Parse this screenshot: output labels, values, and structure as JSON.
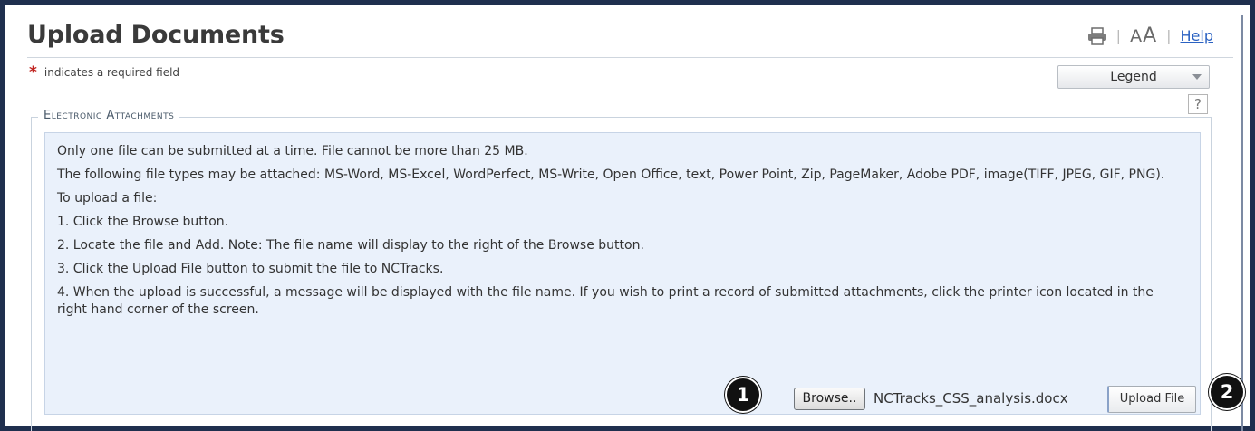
{
  "page": {
    "title": "Upload Documents",
    "required_note": "indicates a required field",
    "required_marker": "*"
  },
  "tools": {
    "print_icon": "printer-icon",
    "font_small": "A",
    "font_large": "A",
    "help_label": "Help"
  },
  "legend_dropdown": {
    "label": "Legend"
  },
  "help_box": {
    "label": "?"
  },
  "section": {
    "legend": "Electronic Attachments",
    "instructions": [
      "Only one file can be submitted at a time. File cannot be more than 25 MB.",
      "The following file types may be attached: MS-Word, MS-Excel, WordPerfect, MS-Write, Open Office, text, Power Point, Zip, PageMaker, Adobe PDF, image(TIFF, JPEG, GIF, PNG).",
      "To upload a file:",
      "1. Click the Browse button.",
      "2. Locate the file and Add. Note: The file name will display to the right of the Browse button.",
      "3. Click the Upload File button to submit the file to NCTracks.",
      "4. When the upload is successful, a message will be displayed with the file name. If you wish to print a record of submitted attachments, click the printer icon located in the right hand corner of the screen."
    ]
  },
  "upload": {
    "browse_label": "Browse..",
    "file_name": "NCTracks_CSS_analysis.docx",
    "upload_label": "Upload File"
  },
  "callouts": {
    "one": "1",
    "two": "2"
  }
}
